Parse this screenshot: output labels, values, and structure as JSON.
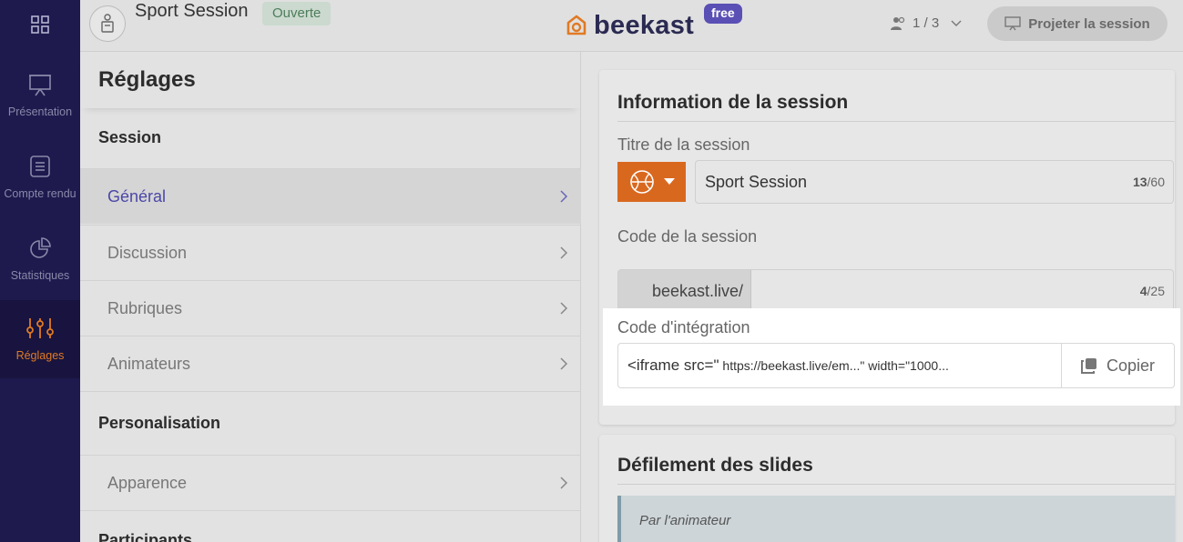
{
  "nav": {
    "items": [
      {
        "label": "Présentation",
        "icon": "presentation-icon"
      },
      {
        "label": "Compte rendu",
        "icon": "report-icon"
      },
      {
        "label": "Statistiques",
        "icon": "pie-chart-icon"
      },
      {
        "label": "Réglages",
        "icon": "sliders-icon",
        "active": true
      }
    ]
  },
  "header": {
    "session_title": "Sport Session",
    "status": "Ouverte",
    "logo_text": "beekast",
    "plan_badge": "free",
    "participants": "1 / 3",
    "project_button": "Projeter la session"
  },
  "settings": {
    "title": "Réglages",
    "sections": [
      {
        "label": "Session",
        "items": [
          "Général",
          "Discussion",
          "Rubriques",
          "Animateurs"
        ],
        "active": "Général"
      },
      {
        "label": "Personalisation",
        "items": [
          "Apparence"
        ]
      },
      {
        "label": "Participants",
        "items": []
      }
    ]
  },
  "main": {
    "info_card": {
      "title": "Information de la session",
      "title_field_label": "Titre de la session",
      "title_value": "Sport Session",
      "title_count": "13",
      "title_max": "/60",
      "code_field_label": "Code de la session",
      "code_prefix": "beekast.live/",
      "code_value": "",
      "code_count": "4",
      "code_max": "/25",
      "embed_label": "Code d'intégration",
      "embed_code_start": "<iframe src=\"",
      "embed_code_rest": " https://beekast.live/em...\" width=\"1000...",
      "copy_button": "Copier"
    },
    "scroll_card": {
      "title": "Défilement des slides",
      "option": "Par l'animateur"
    }
  },
  "colors": {
    "nav_bg": "#1e1a4e",
    "accent_orange": "#d9681f",
    "accent_purple": "#4b47a8",
    "badge_green_bg": "#cbd9cf"
  }
}
